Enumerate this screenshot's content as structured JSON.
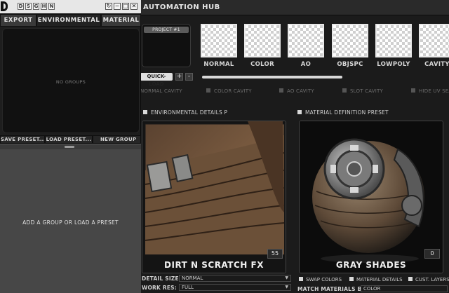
{
  "hub": {
    "title": "AUTOMATION HUB",
    "project_label": "PROJECT #1",
    "maps": [
      "NORMAL",
      "COLOR",
      "AO",
      "OBJSPC",
      "LOWPOLY",
      "CAVITY"
    ],
    "quick_load_label": "QUICK-LOAD",
    "add_label": "+",
    "remove_label": "-",
    "cavity_options": [
      "NORMAL CAVITY",
      "COLOR CAVITY",
      "AO CAVITY",
      "SLOT CAVITY",
      "HIDE UV SEAMS"
    ],
    "env_section_label": "ENVIRONMENTAL DETAILS P",
    "mat_section_label": "MATERIAL DEFINITION PRESET",
    "env_preview": {
      "caption": "DIRT N SCRATCH FX",
      "count": "55"
    },
    "mat_preview": {
      "caption": "GRAY SHADES",
      "count": "0"
    },
    "detail_size_label": "DETAIL SIZE:",
    "detail_size_value": "NORMAL",
    "work_res_label": "WORK RES:",
    "work_res_value": "FULL",
    "swap_colors_label": "SWAP COLORS",
    "material_details_label": "MATERIAL DETAILS",
    "cust_layers_label": "CUST. LAYERS",
    "match_label": "MATCH MATERIALS BY:",
    "match_value": "COLOR"
  },
  "panel": {
    "toolbar_letters": [
      "D",
      "S",
      "G",
      "H",
      "N"
    ],
    "controls": {
      "refresh": "↻",
      "minimize": "−",
      "maximize": "□",
      "close": "✕"
    },
    "tabs": [
      "EXPORT",
      "ENVIRONMENTAL",
      "MATERIAL"
    ],
    "active_tab": "ENVIRONMENTAL",
    "groups_empty": "NO GROUPS",
    "buttons": [
      "SAVE PRESET...",
      "LOAD PRESET...",
      "NEW GROUP"
    ],
    "preset_empty": "ADD A GROUP OR LOAD A PRESET"
  },
  "colors": {
    "background": "#141414",
    "panel": "#1e1e1e",
    "preset_area": "#474747",
    "titlebar_light": "#e7e7e7"
  }
}
